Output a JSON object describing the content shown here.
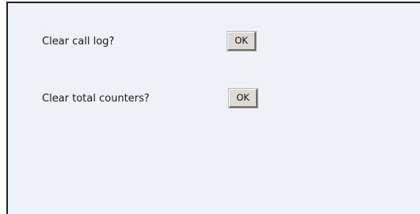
{
  "actions": [
    {
      "label": "Clear call log?",
      "button_label": "OK"
    },
    {
      "label": "Clear total counters?",
      "button_label": "OK"
    }
  ],
  "colors": {
    "panel_background": "#eef1f5",
    "panel_border": "#1f1f1f",
    "button_face": "#dcdad2"
  }
}
